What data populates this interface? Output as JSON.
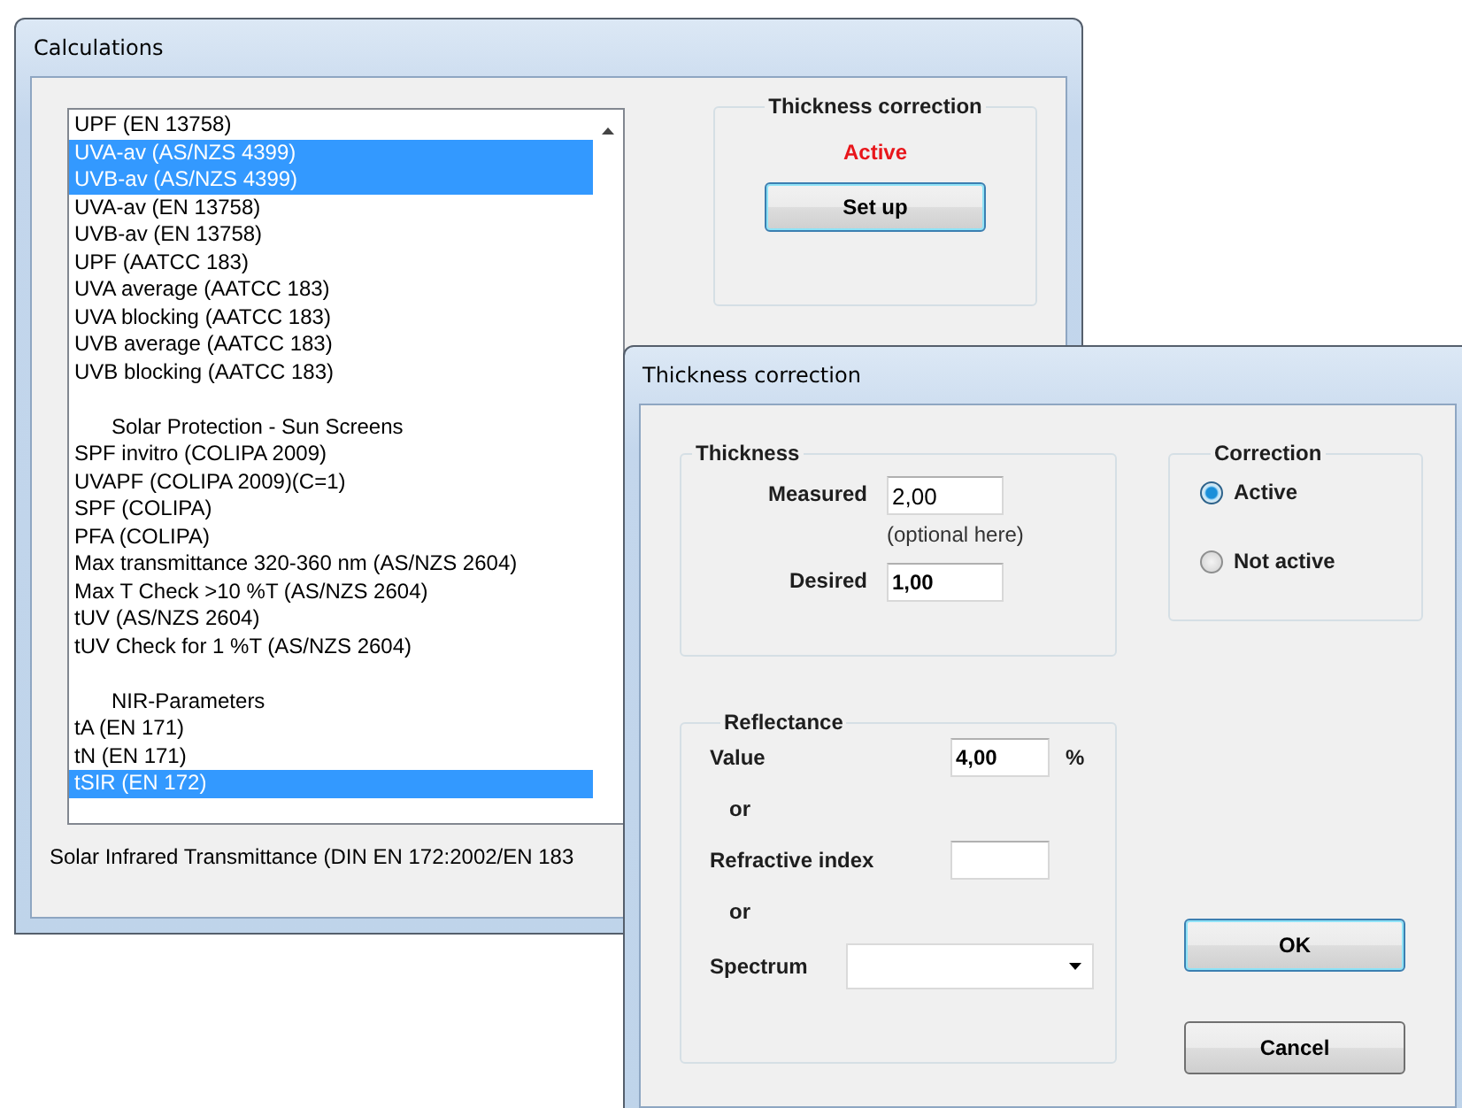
{
  "calculations_window": {
    "title": "Calculations",
    "list_items": [
      {
        "kind": "item",
        "label": "UPF (EN 13758)",
        "selected": false
      },
      {
        "kind": "item",
        "label": "UVA-av (AS/NZS 4399)",
        "selected": true
      },
      {
        "kind": "item",
        "label": "UVB-av (AS/NZS 4399)",
        "selected": true
      },
      {
        "kind": "item",
        "label": "UVA-av (EN 13758)",
        "selected": false
      },
      {
        "kind": "item",
        "label": "UVB-av (EN 13758)",
        "selected": false
      },
      {
        "kind": "item",
        "label": "UPF (AATCC 183)",
        "selected": false
      },
      {
        "kind": "item",
        "label": "UVA average (AATCC 183)",
        "selected": false
      },
      {
        "kind": "item",
        "label": "UVA blocking (AATCC 183)",
        "selected": false
      },
      {
        "kind": "item",
        "label": "UVB average (AATCC 183)",
        "selected": false
      },
      {
        "kind": "item",
        "label": "UVB blocking (AATCC 183)",
        "selected": false
      },
      {
        "kind": "header",
        "label": "Solar Protection - Sun Screens",
        "selected": false
      },
      {
        "kind": "item",
        "label": "SPF invitro (COLIPA 2009)",
        "selected": false
      },
      {
        "kind": "item",
        "label": "UVAPF (COLIPA 2009)(C=1)",
        "selected": false
      },
      {
        "kind": "item",
        "label": "SPF (COLIPA)",
        "selected": false
      },
      {
        "kind": "item",
        "label": "PFA (COLIPA)",
        "selected": false
      },
      {
        "kind": "item",
        "label": "Max transmittance 320-360 nm (AS/NZS 2604)",
        "selected": false
      },
      {
        "kind": "item",
        "label": "Max T Check >10 %T (AS/NZS 2604)",
        "selected": false
      },
      {
        "kind": "item",
        "label": "tUV (AS/NZS 2604)",
        "selected": false
      },
      {
        "kind": "item",
        "label": "tUV Check for 1 %T (AS/NZS 2604)",
        "selected": false
      },
      {
        "kind": "header",
        "label": "NIR-Parameters",
        "selected": false
      },
      {
        "kind": "item",
        "label": "tA (EN 171)",
        "selected": false
      },
      {
        "kind": "item",
        "label": "tN (EN 171)",
        "selected": false
      },
      {
        "kind": "item",
        "label": "tSIR (EN 172)",
        "selected": true
      }
    ],
    "description": "Solar Infrared Transmittance (DIN EN 172:2002/EN 183",
    "thickness_group": {
      "title": "Thickness correction",
      "status": "Active",
      "button": "Set up"
    }
  },
  "thickness_dialog": {
    "title": "Thickness correction",
    "thickness": {
      "title": "Thickness",
      "measured_label": "Measured",
      "measured_value": "2,00",
      "measured_hint": "(optional here)",
      "desired_label": "Desired",
      "desired_value": "1,00"
    },
    "correction": {
      "title": "Correction",
      "options": [
        {
          "label": "Active",
          "selected": true
        },
        {
          "label": "Not active",
          "selected": false
        }
      ]
    },
    "reflectance": {
      "title": "Reflectance",
      "value_label": "Value",
      "value": "4,00",
      "unit": "%",
      "or_1": "or",
      "refractive_label": "Refractive index",
      "or_2": "or",
      "spectrum_label": "Spectrum"
    },
    "buttons": [
      "OK",
      "Cancel"
    ]
  }
}
